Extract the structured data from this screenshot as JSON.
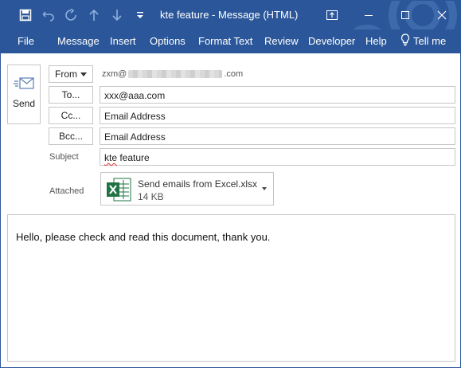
{
  "window": {
    "title": "kte feature  -  Message (HTML)",
    "accent_color": "#2b579a"
  },
  "quick_access": {
    "icons": [
      "save-icon",
      "undo-icon",
      "redo-icon",
      "arrow-up-icon",
      "arrow-down-icon",
      "customize-icon"
    ]
  },
  "window_controls": {
    "icons": [
      "ribbon-display-icon",
      "minimize-icon",
      "maximize-icon",
      "close-icon"
    ]
  },
  "ribbon": {
    "tabs": [
      "File",
      "Message",
      "Insert",
      "Options",
      "Format Text",
      "Review",
      "Developer",
      "Help"
    ],
    "tell_me": "Tell me"
  },
  "compose": {
    "send_label": "Send",
    "from_label": "From",
    "from_prefix": "zxm@",
    "from_suffix": ".com",
    "to_label": "To...",
    "to_value": "xxx@aaa.com",
    "cc_label": "Cc...",
    "cc_value": "Email Address",
    "bcc_label": "Bcc...",
    "bcc_value": "Email Address",
    "subject_label": "Subject",
    "subject_word1": "kte",
    "subject_word2": " feature",
    "attached_label": "Attached"
  },
  "attachment": {
    "name": "Send emails from Excel.xlsx",
    "size": "14 KB",
    "icon": "excel-file-icon"
  },
  "message_body": {
    "text": "Hello, please check and read this document, thank you."
  }
}
